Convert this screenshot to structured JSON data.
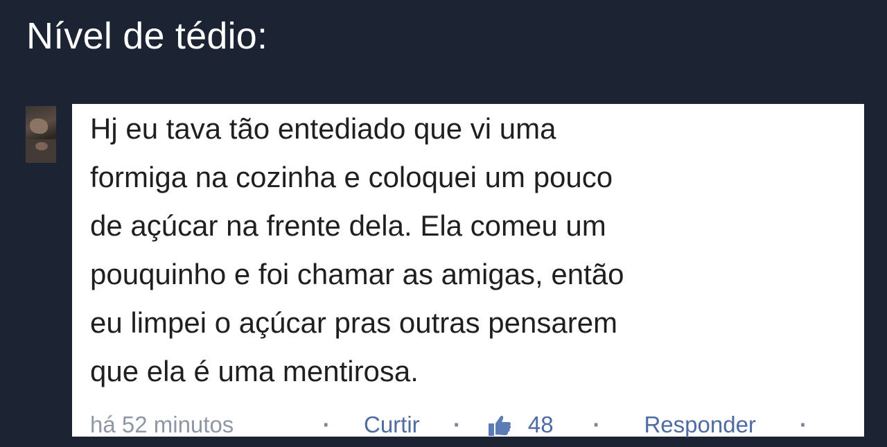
{
  "header": {
    "title": "Nível de tédio:"
  },
  "comment": {
    "text_lines": [
      "Hj eu tava tão entediado que vi uma",
      "formiga na cozinha e coloquei um pouco",
      "de açúcar na frente dela. Ela comeu um",
      "pouquinho e foi chamar as amigas, então",
      "eu limpei o açúcar pras outras pensarem",
      "que ela é uma mentirosa."
    ],
    "footer": {
      "timestamp": "há 52 minutos",
      "separator": "·",
      "like_label": "Curtir",
      "like_icon": "thumbs-up-icon",
      "like_count": "48",
      "reply_label": "Responder"
    }
  },
  "colors": {
    "background": "#1c2433",
    "card": "#ffffff",
    "text": "#1f1f1f",
    "link": "#4e6ba3",
    "meta": "#8f97a4"
  }
}
